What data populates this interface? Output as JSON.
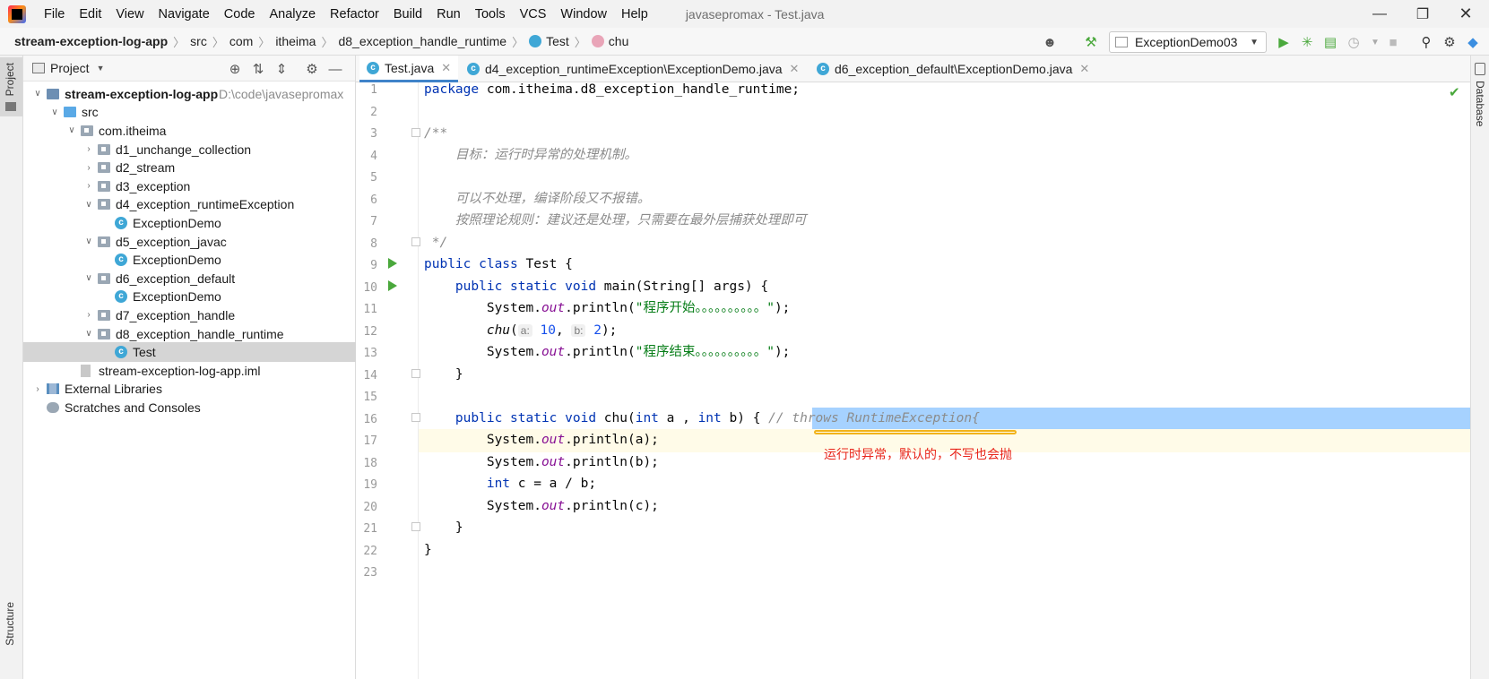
{
  "menubar": {
    "items": [
      "File",
      "Edit",
      "View",
      "Navigate",
      "Code",
      "Analyze",
      "Refactor",
      "Build",
      "Run",
      "Tools",
      "VCS",
      "Window",
      "Help"
    ],
    "window_title": "javasepromax - Test.java"
  },
  "navbar": {
    "crumbs": [
      "stream-exception-log-app",
      "src",
      "com",
      "itheima",
      "d8_exception_handle_runtime",
      "Test",
      "chu"
    ],
    "run_config": "ExceptionDemo03"
  },
  "left_strip": {
    "project_tab": "Project",
    "structure_tab": "Structure"
  },
  "right_strip": {
    "database_tab": "Database"
  },
  "project_panel": {
    "title": "Project",
    "tree": [
      {
        "label": "stream-exception-log-app",
        "hint": "D:\\code\\javasepromax",
        "depth": 0,
        "expanded": true,
        "icon": "module-folder-icon"
      },
      {
        "label": "src",
        "depth": 1,
        "expanded": true,
        "icon": "source-folder-icon"
      },
      {
        "label": "com.itheima",
        "depth": 2,
        "expanded": true,
        "icon": "package-icon"
      },
      {
        "label": "d1_unchange_collection",
        "depth": 3,
        "expanded": false,
        "icon": "package-icon"
      },
      {
        "label": "d2_stream",
        "depth": 3,
        "expanded": false,
        "icon": "package-icon"
      },
      {
        "label": "d3_exception",
        "depth": 3,
        "expanded": false,
        "icon": "package-icon"
      },
      {
        "label": "d4_exception_runtimeException",
        "depth": 3,
        "expanded": true,
        "icon": "package-icon"
      },
      {
        "label": "ExceptionDemo",
        "depth": 4,
        "icon": "class-icon"
      },
      {
        "label": "d5_exception_javac",
        "depth": 3,
        "expanded": true,
        "icon": "package-icon"
      },
      {
        "label": "ExceptionDemo",
        "depth": 4,
        "icon": "class-icon"
      },
      {
        "label": "d6_exception_default",
        "depth": 3,
        "expanded": true,
        "icon": "package-icon"
      },
      {
        "label": "ExceptionDemo",
        "depth": 4,
        "icon": "class-icon"
      },
      {
        "label": "d7_exception_handle",
        "depth": 3,
        "expanded": false,
        "icon": "package-icon"
      },
      {
        "label": "d8_exception_handle_runtime",
        "depth": 3,
        "expanded": true,
        "icon": "package-icon"
      },
      {
        "label": "Test",
        "depth": 4,
        "icon": "class-icon",
        "selected": true
      },
      {
        "label": "stream-exception-log-app.iml",
        "depth": 2,
        "icon": "iml-file-icon"
      },
      {
        "label": "External Libraries",
        "depth": 0,
        "expanded": false,
        "icon": "libraries-icon"
      },
      {
        "label": "Scratches and Consoles",
        "depth": 0,
        "icon": "scratches-icon"
      }
    ]
  },
  "editor_tabs": [
    {
      "label": "Test.java",
      "active": true
    },
    {
      "label": "d4_exception_runtimeException\\ExceptionDemo.java",
      "active": false
    },
    {
      "label": "d6_exception_default\\ExceptionDemo.java",
      "active": false
    }
  ],
  "editor": {
    "line_numbers": [
      "1",
      "2",
      "3",
      "4",
      "5",
      "6",
      "7",
      "8",
      "9",
      "10",
      "11",
      "12",
      "13",
      "14",
      "15",
      "16",
      "17",
      "18",
      "19",
      "20",
      "21",
      "22",
      "23"
    ],
    "code": {
      "l1_kw": "package",
      "l1_rest": " com.itheima.d8_exception_handle_runtime;",
      "l3": "/**",
      "l4": "    目标：运行时异常的处理机制。",
      "l6": "    可以不处理，编译阶段又不报错。",
      "l7": "    按照理论规则：建议还是处理，只需要在最外层捕获处理即可",
      "l8": " */",
      "l9_kw": "public class",
      "l9_rest": " Test {",
      "l10_kw": "    public static void",
      "l10_rest": " main(String[] args) {",
      "l11_a": "        System.",
      "l11_field": "out",
      "l11_b": ".println(",
      "l11_str": "\"程序开始。。。。。。。。。。\"",
      "l11_c": ");",
      "l12_fn": "        chu",
      "l12_a": "(",
      "l12_hint_a": "a:",
      "l12_num_a": "10",
      "l12_b": ", ",
      "l12_hint_b": "b:",
      "l12_num_b": "2",
      "l12_c": ");",
      "l13_a": "        System.",
      "l13_field": "out",
      "l13_b": ".println(",
      "l13_str": "\"程序结束。。。。。。。。。。\"",
      "l13_c": ");",
      "l14": "    }",
      "l16_kw": "    public static void",
      "l16_a": " chu(",
      "l16_kw2": "int",
      "l16_b": " a , ",
      "l16_kw3": "int",
      "l16_c": " b) { ",
      "l16_cm": "// throws RuntimeException{",
      "l17_a": "        System.",
      "l17_field": "out",
      "l17_b": ".println(a);",
      "l18_a": "        System.",
      "l18_field": "out",
      "l18_b": ".println(b);",
      "l19_kw": "        int",
      "l19_rest": " c = a / b;",
      "l20_a": "        System.",
      "l20_field": "out",
      "l20_b": ".println(c);",
      "l21": "    }",
      "l22": "}"
    },
    "annotation": "运行时异常，默认的，不写也会抛"
  },
  "colors": {
    "keyword": "#0033b3",
    "string": "#067d17",
    "comment": "#8c8c8c",
    "field": "#871094",
    "selection": "#a6d2ff",
    "annotation": "#e8261c",
    "underline": "#f2b31b",
    "tab_active": "#4083c9"
  }
}
